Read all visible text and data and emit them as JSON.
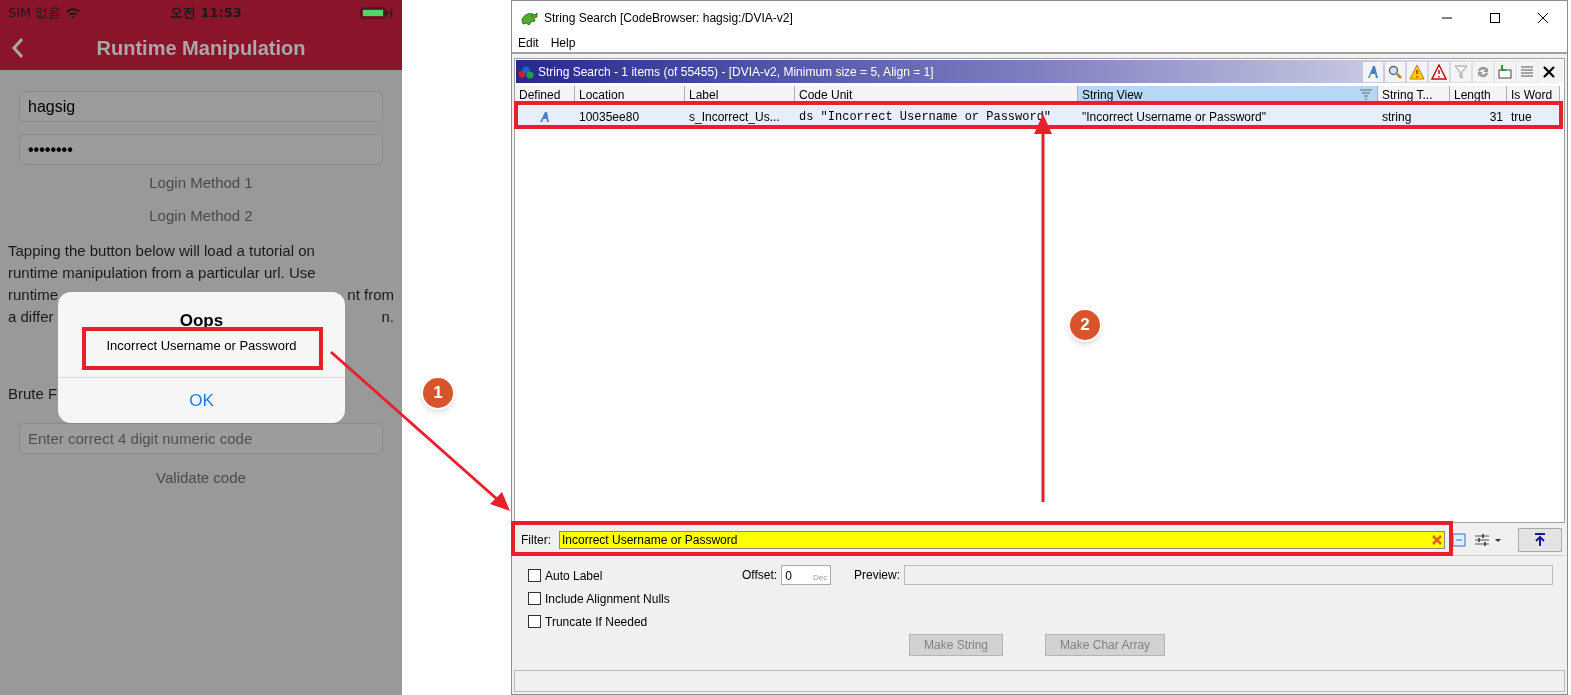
{
  "phone": {
    "status_bar": {
      "carrier": "SIM 없음",
      "time": "오전 11:53"
    },
    "nav": {
      "title": "Runtime Manipulation"
    },
    "username_field": {
      "value": "hagsig"
    },
    "password_field": {
      "value": "••••••••"
    },
    "login_buttons": [
      "Login Method 1",
      "Login Method 2"
    ],
    "paragraph_lines": [
      {
        "left": "Tapping the button below will load a tutorial on"
      },
      {
        "left": "runtime manipulation from a particular url. Use"
      },
      {
        "left": "runtime",
        "right": "nt from"
      },
      {
        "left": "a differ",
        "right": "n."
      }
    ],
    "brute_force_label": "Brute F",
    "code_field": {
      "placeholder": "Enter correct 4 digit numeric code"
    },
    "validate_button": "Validate code",
    "alert": {
      "title": "Oops",
      "message": "Incorrect Username or Password",
      "button": "OK"
    }
  },
  "window": {
    "title": "String Search [CodeBrowser: hagsig:/DVIA-v2]",
    "menu": [
      "Edit",
      "Help"
    ],
    "panel_title": "String Search - 1 items (of 55455) - [DVIA-v2, Minimum size = 5, Align = 1]",
    "columns": [
      {
        "label": "Defined",
        "sorted": false
      },
      {
        "label": "Location",
        "sorted": false
      },
      {
        "label": "Label",
        "sorted": false
      },
      {
        "label": "Code Unit",
        "sorted": false
      },
      {
        "label": "String View",
        "sorted": true
      },
      {
        "label": "String T...",
        "sorted": false
      },
      {
        "label": "Length",
        "sorted": false
      },
      {
        "label": "Is Word",
        "sorted": false
      }
    ],
    "rows": [
      {
        "selected": true,
        "location": "10035ee80",
        "label": "s_Incorrect_Us...",
        "code_unit": "ds \"Incorrect Username or Password\"",
        "string_view": "\"Incorrect Username or Password\"",
        "string_type": "string",
        "length": "31",
        "is_word": "true"
      }
    ],
    "filter": {
      "label": "Filter:",
      "value": "Incorrect Username or Password"
    },
    "options": [
      {
        "label": "Auto Label",
        "checked": false
      },
      {
        "label": "Include Alignment Nulls",
        "checked": false
      },
      {
        "label": "Truncate If Needed",
        "checked": false
      }
    ],
    "offset": {
      "label": "Offset:",
      "value": "0",
      "unit": "Dec"
    },
    "preview": {
      "label": "Preview:"
    },
    "buttons": [
      {
        "label": "Make String",
        "disabled": true
      },
      {
        "label": "Make Char Array",
        "disabled": true
      }
    ]
  },
  "annotations": [
    {
      "number": "1"
    },
    {
      "number": "2"
    }
  ]
}
